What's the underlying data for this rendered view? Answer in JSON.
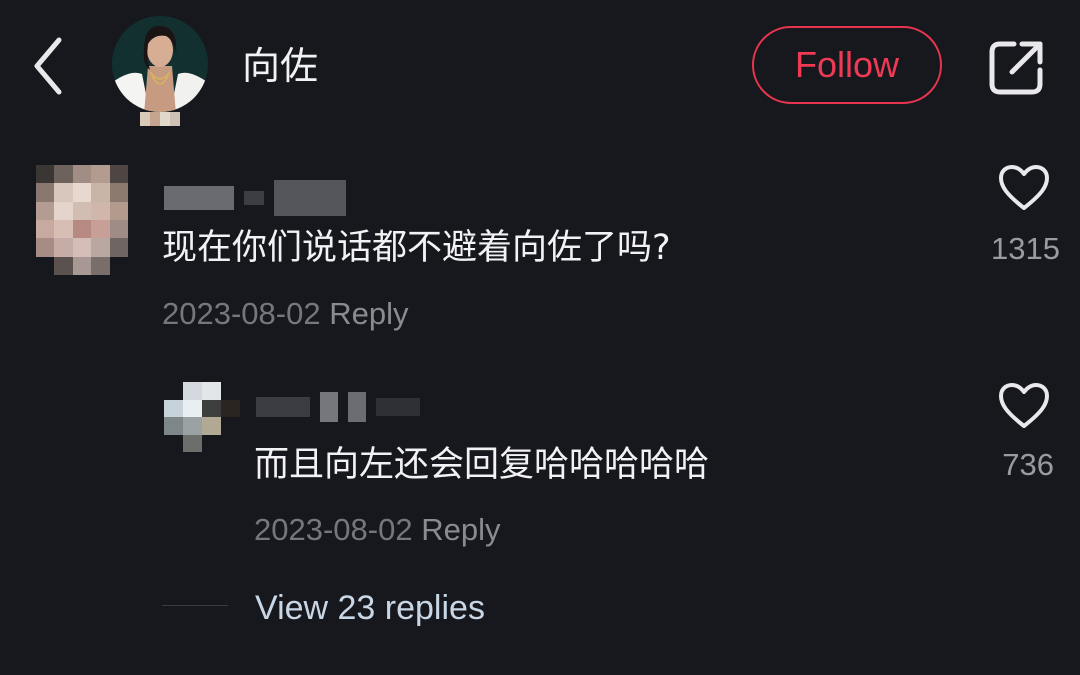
{
  "header": {
    "name": "向佐",
    "follow_label": "Follow",
    "back_icon": "chevron-left-icon",
    "share_icon": "share-external-icon"
  },
  "comments": [
    {
      "text": "现在你们说话都不避着向佐了吗?",
      "date": "2023-08-02",
      "reply_label": "Reply",
      "likes": "1315"
    },
    {
      "text": "而且向左还会回复哈哈哈哈哈",
      "date": "2023-08-02",
      "reply_label": "Reply",
      "likes": "736"
    }
  ],
  "view_replies": "View 23 replies",
  "colors": {
    "background": "#17181d",
    "accent": "#ef3a55",
    "muted": "#76777e",
    "link": "#c8d6e6"
  }
}
